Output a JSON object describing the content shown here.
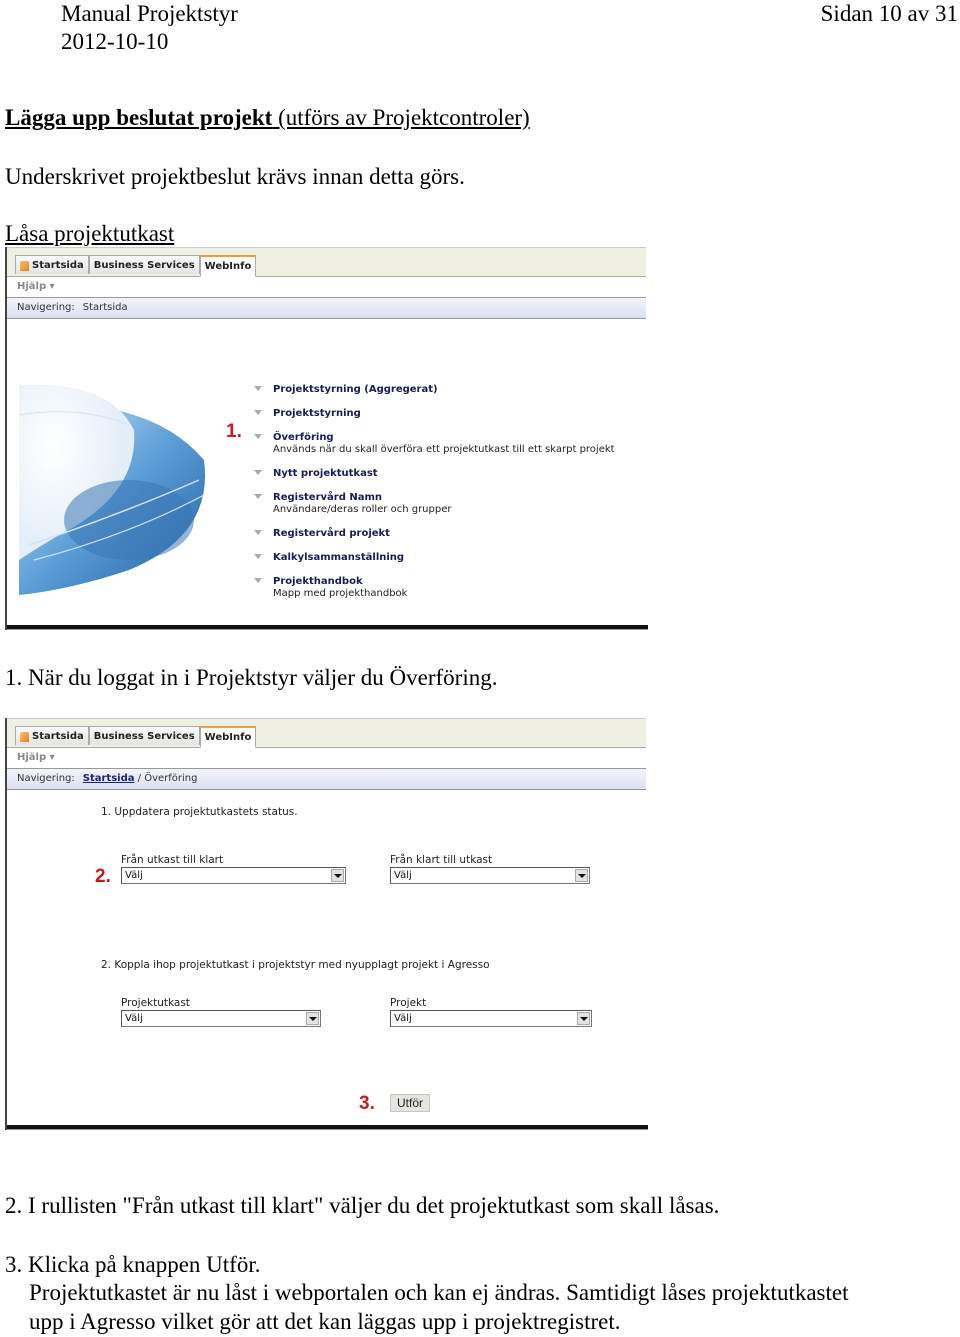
{
  "header": {
    "doc_title": "Manual Projektstyr",
    "date": "2012-10-10",
    "page_indicator": "Sidan 10 av 31"
  },
  "section": {
    "title_bold": "Lägga upp beslutat projekt",
    "title_rest": " (utförs av Projektcontroler)",
    "intro": "Underskrivet projektbeslut krävs innan detta görs.",
    "subheading": "Låsa projektutkast"
  },
  "screenshot1": {
    "tabs": [
      {
        "label": "Startsida",
        "icon": "home-icon"
      },
      {
        "label": "Business Services"
      },
      {
        "label": "WebInfo",
        "active": true
      }
    ],
    "help_menu": "Hjälp ▾",
    "nav_label": "Navigering:",
    "nav_current": "Startsida",
    "marker": "1.",
    "menu": [
      {
        "label": "Projektstyrning (Aggregerat)",
        "desc": ""
      },
      {
        "label": "Projektstyrning",
        "desc": ""
      },
      {
        "label": "Överföring",
        "desc": "Används när du skall överföra ett projektutkast till ett skarpt projekt"
      },
      {
        "label": "Nytt projektutkast",
        "desc": ""
      },
      {
        "label": "Registervård Namn",
        "desc": "Användare/deras roller och grupper"
      },
      {
        "label": "Registervård projekt",
        "desc": ""
      },
      {
        "label": "Kalkylsammanställning",
        "desc": ""
      },
      {
        "label": "Projekthandbok",
        "desc": "Mapp med projekthandbok"
      }
    ]
  },
  "caption1": "1. När du loggat in i Projektstyr väljer du Överföring.",
  "screenshot2": {
    "tabs": [
      {
        "label": "Startsida",
        "icon": "home-icon"
      },
      {
        "label": "Business Services"
      },
      {
        "label": "WebInfo",
        "active": true
      }
    ],
    "help_menu": "Hjälp ▾",
    "nav_label": "Navigering:",
    "nav_link": "Startsida",
    "nav_current": "/ Överföring",
    "heading1": "1. Uppdatera projektutkastets status.",
    "marker2": "2.",
    "select_utkast_klart": {
      "label": "Från utkast till klart",
      "value": "Välj"
    },
    "select_klart_utkast": {
      "label": "Från klart till utkast",
      "value": "Välj"
    },
    "heading2": "2. Koppla ihop projektutkast i projektstyr med nyupplagt projekt i Agresso",
    "select_projektutkast": {
      "label": "Projektutkast",
      "value": "Välj"
    },
    "select_projekt": {
      "label": "Projekt",
      "value": "Välj"
    },
    "marker3": "3.",
    "submit_label": "Utför"
  },
  "instructions": {
    "step2": "2. I rullisten \"Från utkast till klart\" väljer du det projektutkast som skall låsas.",
    "step3": "3. Klicka på knappen Utför.",
    "step3_line2": "Projektutkastet är nu låst i webportalen och kan ej ändras. Samtidigt låses projektutkastet",
    "step3_line3": "upp i Agresso vilket gör att det kan läggas upp i projektregistret."
  },
  "colors": {
    "marker_red": "#d0161d",
    "menu_label": "#1a1a5e",
    "active_tab_accent": "#e8a23a"
  }
}
